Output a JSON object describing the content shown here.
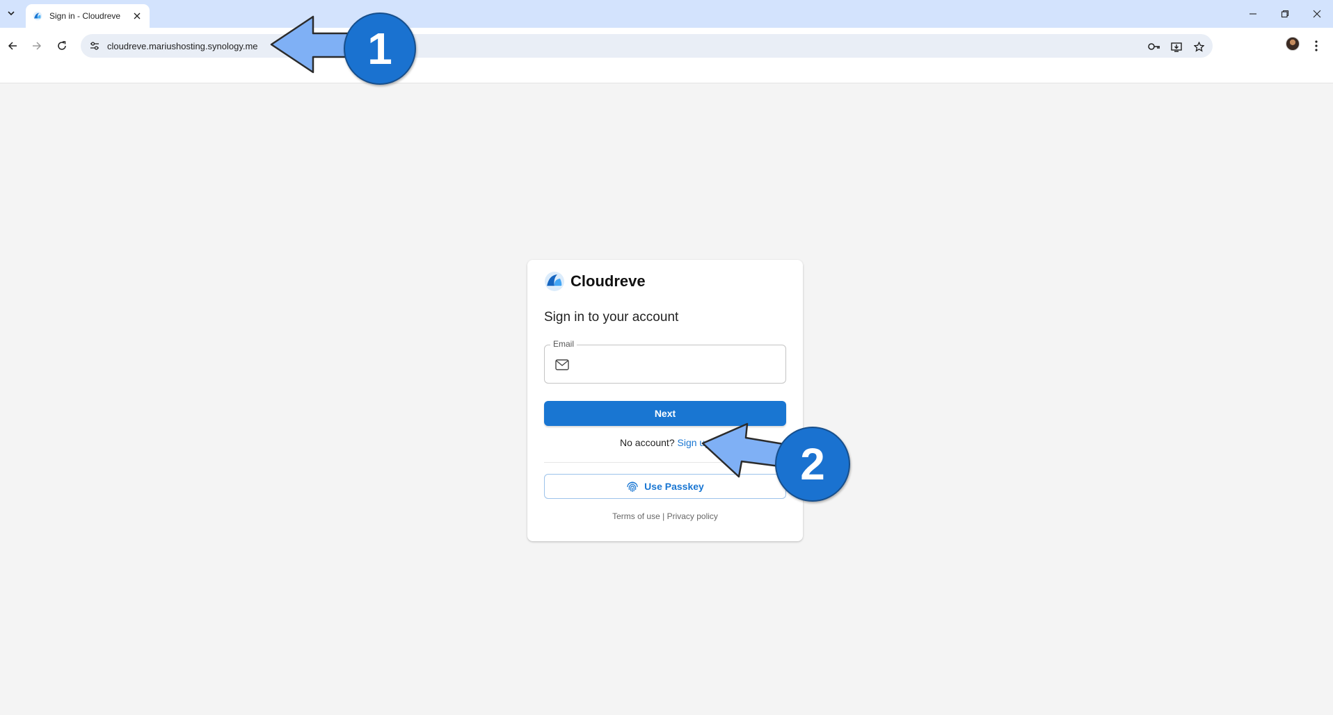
{
  "browser": {
    "tab_title": "Sign in - Cloudreve",
    "url": "cloudreve.mariushosting.synology.me"
  },
  "login": {
    "brand_name": "Cloudreve",
    "title": "Sign in to your account",
    "email_label": "Email",
    "email_value": "",
    "next_label": "Next",
    "no_account_text": "No account?",
    "sign_up_label": "Sign up",
    "passkey_label": "Use Passkey",
    "terms_label": "Terms of use",
    "separator": "|",
    "privacy_label": "Privacy policy"
  },
  "callouts": {
    "first": "1",
    "second": "2"
  },
  "colors": {
    "accent": "#1976d2",
    "callout_arrow": "#7fb0f5",
    "callout_circle": "#1a72d0",
    "tabstrip": "#d3e3fd"
  },
  "icons": [
    "tab-search-icon",
    "cloudreve-favicon",
    "close-icon",
    "minimize-icon",
    "restore-icon",
    "back-icon",
    "forward-icon",
    "reload-icon",
    "site-settings-icon",
    "password-key-icon",
    "install-app-icon",
    "bookmark-star-icon",
    "profile-avatar",
    "menu-kebab-icon",
    "mail-icon",
    "fingerprint-icon"
  ]
}
